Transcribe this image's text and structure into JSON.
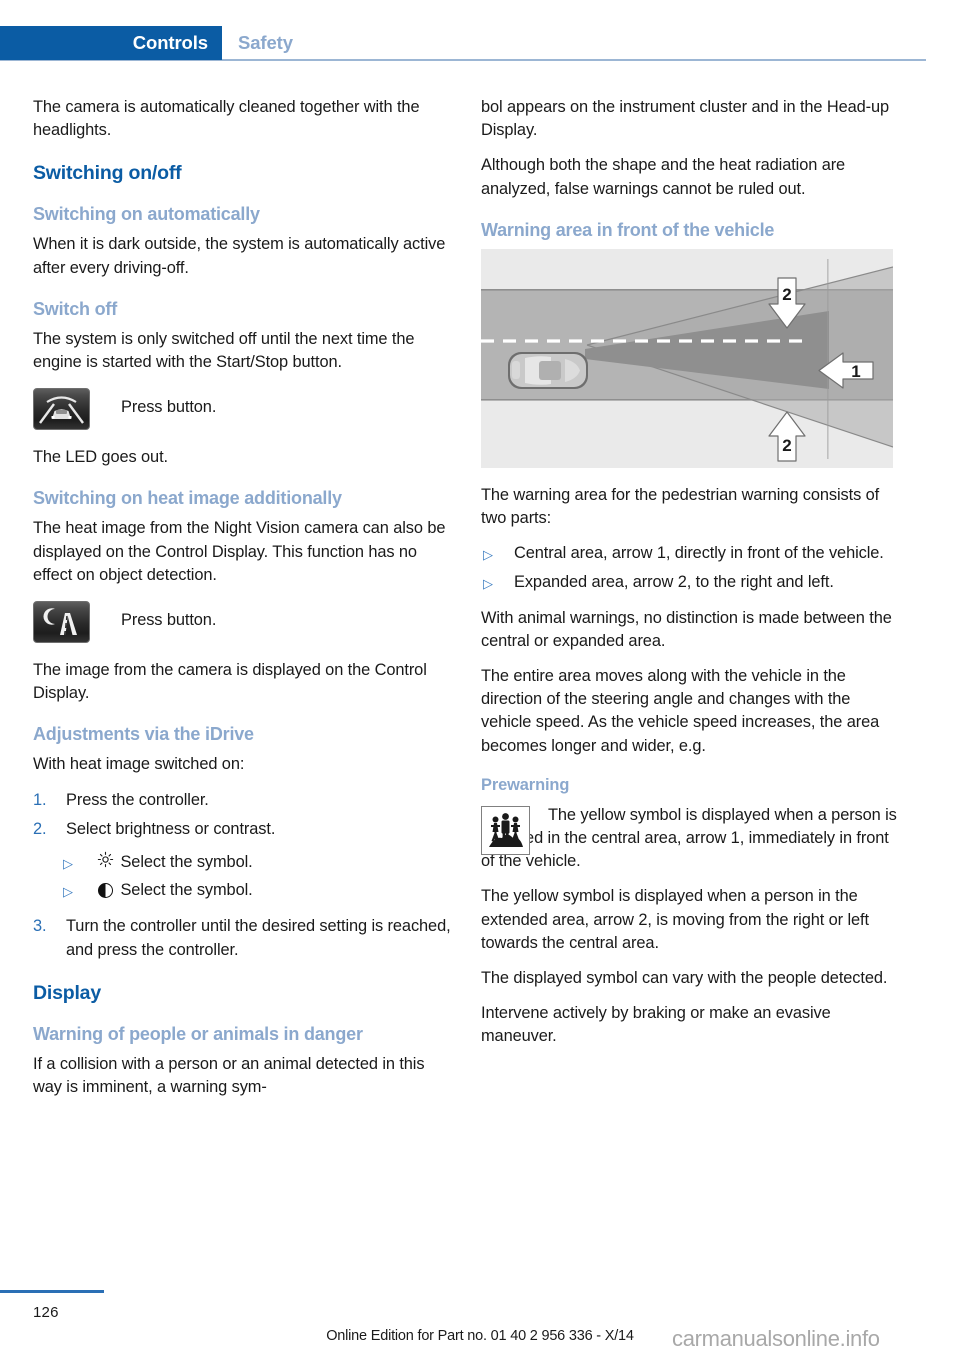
{
  "header": {
    "active_tab": "Controls",
    "inactive_tab": "Safety",
    "active_bg": "#0b5ca4",
    "inactive_color": "#8ba8cd"
  },
  "colors": {
    "heading_primary": "#0b5ca4",
    "heading_secondary": "#8ba8cd",
    "list_marker": "#2a6fb5",
    "body_text": "#1a1a1a",
    "watermark": "#a8a8a8"
  },
  "left_column": {
    "intro_paragraph": "The camera is automatically cleaned together with the headlights.",
    "section_switching": "Switching on/off",
    "sub_switch_auto": "Switching on automatically",
    "p_switch_auto": "When it is dark outside, the system is automatically active after every driving-off.",
    "sub_switch_off": "Switch off",
    "p_switch_off": "The system is only switched off until the next time the engine is started with the Start/Stop button.",
    "press_button_1": "Press button.",
    "p_led": "The LED goes out.",
    "sub_heat_image": "Switching on heat image additionally",
    "p_heat_image": "The heat image from the Night Vision camera can also be displayed on the Control Display. This function has no effect on object detection.",
    "press_button_2": "Press button.",
    "p_image_displayed": "The image from the camera is displayed on the Control Display.",
    "sub_idrive": "Adjustments via the iDrive",
    "p_with_heat": "With heat image switched on:",
    "steps": [
      {
        "num": "1.",
        "text": "Press the controller."
      },
      {
        "num": "2.",
        "text": "Select brightness or contrast."
      },
      {
        "num": "3.",
        "text": "Turn the controller until the desired setting is reached, and press the controller."
      }
    ],
    "symbol_bullets": [
      {
        "marker": "▷",
        "icon": "brightness-sun-icon",
        "text": "Select the symbol."
      },
      {
        "marker": "▷",
        "icon": "contrast-half-circle-icon",
        "text": "Select the symbol."
      }
    ],
    "section_display": "Display",
    "sub_warning_people": "Warning of people or animals in danger",
    "p_collision": "If a collision with a person or an animal detected in this way is imminent, a warning sym-"
  },
  "right_column": {
    "p_continued": "bol appears on the instrument cluster and in the Head-up Display.",
    "p_although": "Although both the shape and the heat radiation are analyzed, false warnings cannot be ruled out.",
    "sub_warning_area": "Warning area in front of the vehicle",
    "p_warning_area": "The warning area for the pedestrian warning consists of two parts:",
    "area_bullets": [
      {
        "marker": "▷",
        "text": "Central area, arrow 1, directly in front of the vehicle."
      },
      {
        "marker": "▷",
        "text": "Expanded area, arrow 2, to the right and left."
      }
    ],
    "p_animal": "With animal warnings, no distinction is made between the central or expanded area.",
    "p_entire_area": "The entire area moves along with the vehicle in the direction of the steering angle and changes with the vehicle speed. As the vehicle speed increases, the area becomes longer and wider, e.g.",
    "sub_prewarning": "Prewarning",
    "p_prewarn_lead": "The yellow symbol is displayed when a person is detected in the central area, arrow 1, immediately in front of the vehicle.",
    "p_prewarn_2": "The yellow symbol is displayed when a person in the extended area, arrow 2, is moving from the right or left towards the central area.",
    "p_prewarn_3": "The displayed symbol can vary with the people detected.",
    "p_prewarn_4": "Intervene actively by braking or make an evasive maneuver."
  },
  "diagram": {
    "label_central": "1",
    "label_expanded_top": "2",
    "label_expanded_bottom": "2"
  },
  "icons": {
    "night_vision_button": "night-vision-car-beams-icon",
    "heat_image_button": "moon-road-heat-image-icon",
    "pedestrian_warning": "pedestrian-group-warning-icon"
  },
  "footer": {
    "page_number": "126",
    "edition_text": "Online Edition for Part no. 01 40 2 956 336 - X/14",
    "watermark": "carmanualsonline.info"
  }
}
